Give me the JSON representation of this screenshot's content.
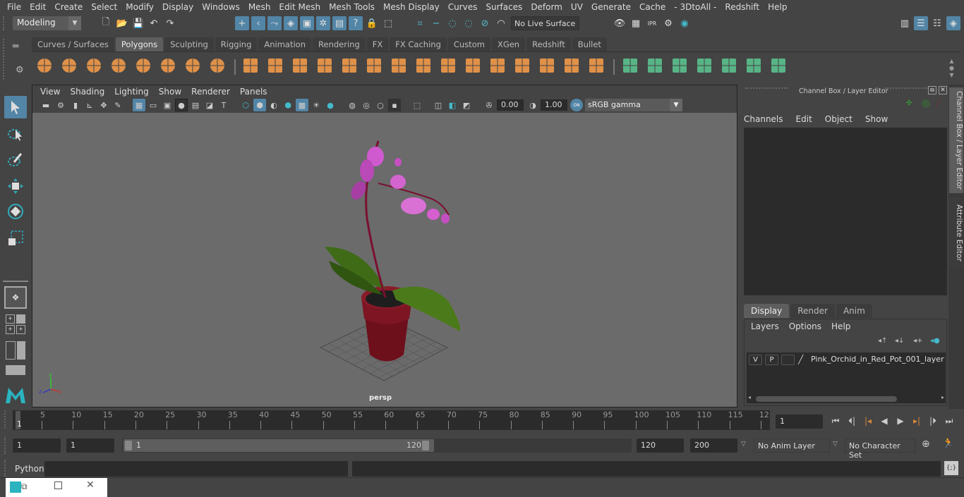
{
  "menubar": [
    "File",
    "Edit",
    "Create",
    "Select",
    "Modify",
    "Display",
    "Windows",
    "Mesh",
    "Edit Mesh",
    "Mesh Tools",
    "Mesh Display",
    "Curves",
    "Surfaces",
    "Deform",
    "UV",
    "Generate",
    "Cache",
    "- 3DtoAll -",
    "Redshift",
    "Help"
  ],
  "statusline": {
    "mode": "Modeling",
    "live_surface": "No Live Surface",
    "icons": [
      "new-scene-icon",
      "open-scene-icon",
      "save-scene-icon",
      "undo-icon",
      "redo-icon",
      "select-by-hierarchy-icon",
      "select-object-icon",
      "select-component-icon",
      "select-vertex-icon",
      "select-face-icon",
      "select-multi-icon",
      "select-render-icon",
      "select-misc-icon",
      "lock-icon",
      "select-highlight-icon",
      "snap-grid-icon",
      "snap-curve-icon",
      "snap-point-icon",
      "snap-view-icon",
      "snap-surface-icon",
      "snap-live-icon",
      "render-view-icon",
      "render-current-icon",
      "ipr-render-icon",
      "render-settings-icon",
      "hypershade-icon"
    ],
    "right_icons": [
      "modeling-toolkit-icon",
      "attribute-editor-icon",
      "tool-settings-icon",
      "channel-box-icon"
    ]
  },
  "shelf": {
    "tabs": [
      "Curves / Surfaces",
      "Polygons",
      "Sculpting",
      "Rigging",
      "Animation",
      "Rendering",
      "FX",
      "FX Caching",
      "Custom",
      "XGen",
      "Redshift",
      "Bullet"
    ],
    "active_tab": "Polygons",
    "icons": [
      "poly-sphere-icon",
      "poly-cube-icon",
      "poly-cylinder-icon",
      "poly-cone-icon",
      "poly-plane-icon",
      "poly-torus-icon",
      "poly-pyramid-icon",
      "poly-pipe-icon",
      "combine-icon",
      "separate-icon",
      "mirror-icon",
      "smooth-icon",
      "extract-icon",
      "bevel-icon",
      "extrude-icon",
      "bridge-icon",
      "multi-cut-icon",
      "insert-edge-loop-icon",
      "fill-hole-icon",
      "append-poly-icon",
      "edge-loop-icon",
      "merge-icon",
      "target-weld-icon",
      "quad-draw-icon",
      "uv-planar-icon",
      "uv-cylindrical-icon",
      "uv-spherical-icon",
      "uv-automatic-icon",
      "uv-unfold-icon",
      "uv-editor-icon",
      "uv-cut-sew-icon"
    ]
  },
  "viewport": {
    "menu": [
      "View",
      "Shading",
      "Lighting",
      "Show",
      "Renderer",
      "Panels"
    ],
    "exposure": "0.00",
    "gamma": "1.00",
    "color_mgmt_on": "ON",
    "color_space": "sRGB gamma",
    "camera_label": "persp",
    "axis": {
      "x": "x",
      "y": "y",
      "z": "z"
    }
  },
  "channel_box": {
    "title": "Channel Box / Layer Editor",
    "menu": [
      "Channels",
      "Edit",
      "Object",
      "Show"
    ]
  },
  "side_tabs": [
    "Channel Box / Layer Editor",
    "Attribute Editor"
  ],
  "layer_editor": {
    "tabs": [
      "Display",
      "Render",
      "Anim"
    ],
    "active_tab": "Display",
    "menu": [
      "Layers",
      "Options",
      "Help"
    ],
    "layers": [
      {
        "v": "V",
        "p": "P",
        "name": "Pink_Orchid_in_Red_Pot_001_layer"
      }
    ]
  },
  "timeline": {
    "ticks": [
      "5",
      "10",
      "15",
      "20",
      "25",
      "30",
      "35",
      "40",
      "45",
      "50",
      "55",
      "60",
      "65",
      "70",
      "75",
      "80",
      "85",
      "90",
      "95",
      "100",
      "105",
      "110",
      "115",
      "12"
    ],
    "current_marker": "1",
    "current_frame": "1"
  },
  "range": {
    "start_frame": "1",
    "playback_start": "1",
    "slider_start": "1",
    "slider_end": "120",
    "playback_end": "120",
    "end_frame": "200",
    "anim_layer": "No Anim Layer",
    "character_set": "No Character Set"
  },
  "command_line": {
    "language": "Python",
    "input": "",
    "output": ""
  }
}
